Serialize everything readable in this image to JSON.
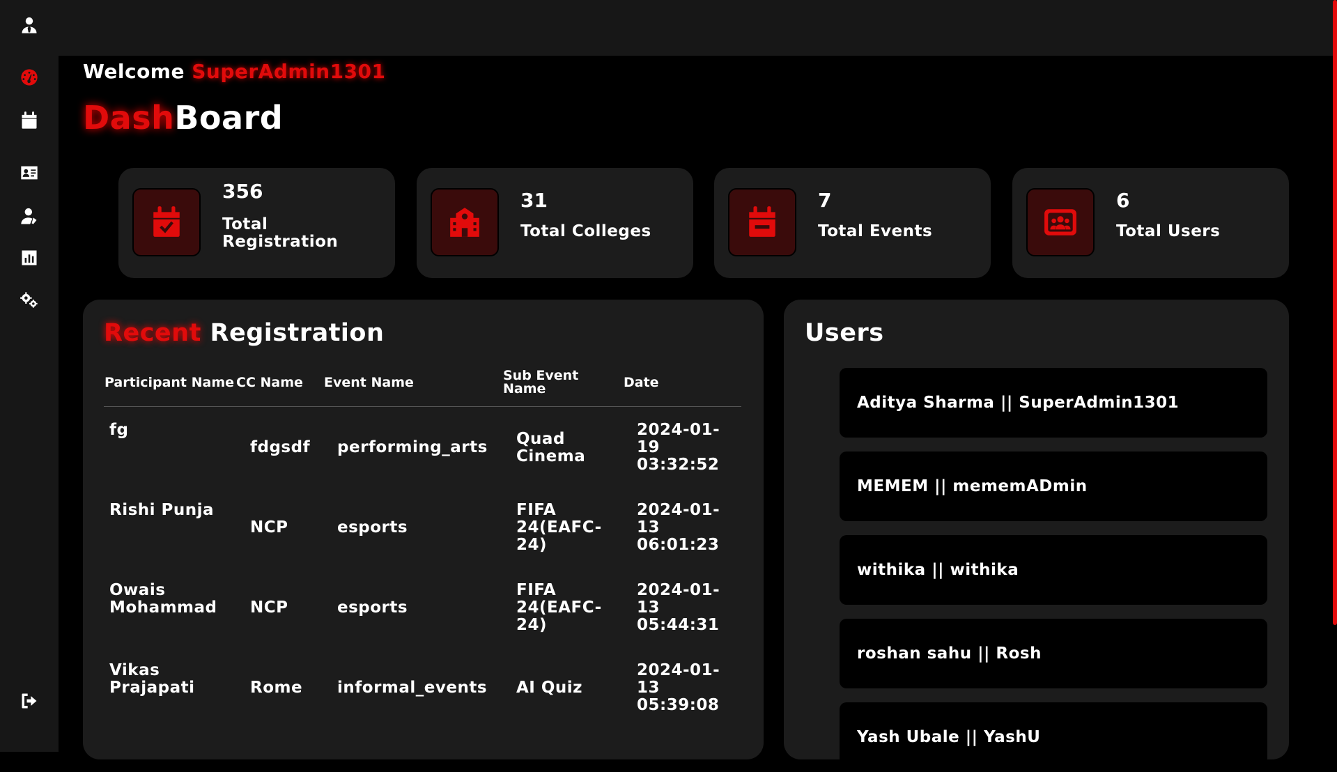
{
  "header": {
    "welcome_text": "Welcome",
    "username": "SuperAdmin1301",
    "title_accent": "Dash",
    "title_rest": "Board"
  },
  "sidebar": {
    "items": [
      {
        "name": "profile",
        "icon": "user-tie-icon"
      },
      {
        "name": "dashboard",
        "icon": "gauge-icon",
        "active": true
      },
      {
        "name": "events",
        "icon": "calendar-icon"
      },
      {
        "name": "registrations",
        "icon": "id-card-icon"
      },
      {
        "name": "users",
        "icon": "user-icon"
      },
      {
        "name": "reports",
        "icon": "chart-icon"
      },
      {
        "name": "settings",
        "icon": "gears-icon"
      },
      {
        "name": "logout",
        "icon": "sign-out-icon"
      }
    ]
  },
  "stats": [
    {
      "value": "356",
      "label": "Total Registration",
      "icon": "calendar-check-icon"
    },
    {
      "value": "31",
      "label": "Total Colleges",
      "icon": "school-icon"
    },
    {
      "value": "7",
      "label": "Total Events",
      "icon": "calendar-minus-icon"
    },
    {
      "value": "6",
      "label": "Total Users",
      "icon": "users-rectangle-icon"
    }
  ],
  "recent": {
    "title_accent": "Recent",
    "title_rest": " Registration",
    "columns": [
      "Participant Name",
      "CC Name",
      "Event Name",
      "Sub Event Name",
      "Date"
    ],
    "rows": [
      {
        "participant": "fg",
        "cc": "fdgsdf",
        "event": "performing_arts",
        "sub_event": "Quad Cinema",
        "date": "2024-01-19 03:32:52"
      },
      {
        "participant": "Rishi Punja",
        "cc": "NCP",
        "event": "esports",
        "sub_event": "FIFA 24(EAFC-24)",
        "date": "2024-01-13 06:01:23"
      },
      {
        "participant": "Owais Mohammad",
        "cc": "NCP",
        "event": "esports",
        "sub_event": "FIFA 24(EAFC-24)",
        "date": "2024-01-13 05:44:31"
      },
      {
        "participant": "Vikas Prajapati",
        "cc": "Rome",
        "event": "informal_events",
        "sub_event": "AI Quiz",
        "date": "2024-01-13 05:39:08"
      }
    ]
  },
  "users_panel": {
    "title": "Users",
    "items": [
      "Aditya Sharma || SuperAdmin1301",
      "MEMEM || mememADmin",
      "withika || withika",
      "roshan sahu || Rosh",
      "Yash Ubale || YashU"
    ]
  },
  "colors": {
    "accent": "#e10b0b",
    "panel": "#1c1c1c",
    "sidebar": "#171717",
    "icon_bg": "#3a0b0b"
  }
}
